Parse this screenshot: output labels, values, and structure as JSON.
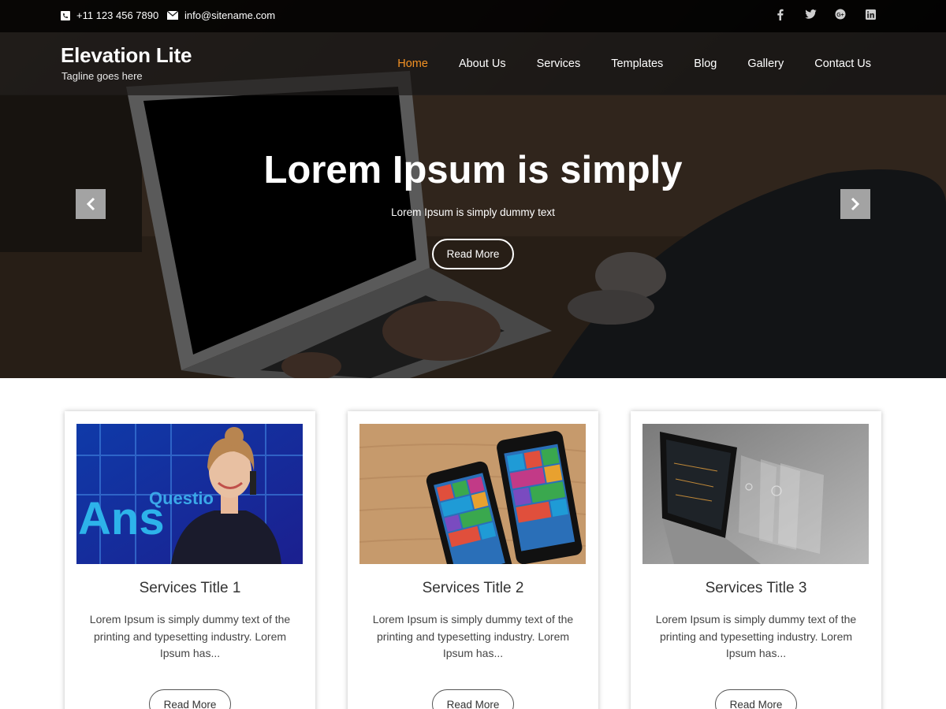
{
  "topbar": {
    "phone": "+11 123 456 7890",
    "email": "info@sitename.com",
    "social_icons": [
      "facebook-icon",
      "twitter-icon",
      "google-plus-icon",
      "linkedin-icon"
    ]
  },
  "header": {
    "site_title": "Elevation Lite",
    "tagline": "Tagline goes here",
    "nav": [
      {
        "label": "Home",
        "active": true
      },
      {
        "label": "About Us"
      },
      {
        "label": "Services"
      },
      {
        "label": "Templates"
      },
      {
        "label": "Blog"
      },
      {
        "label": "Gallery"
      },
      {
        "label": "Contact Us"
      }
    ],
    "accent_color": "#f39224"
  },
  "hero": {
    "title": "Lorem Ipsum is simply",
    "subtitle": "Lorem Ipsum is simply dummy text",
    "button": "Read More"
  },
  "services": [
    {
      "title": "Services Title 1",
      "text": "Lorem Ipsum is simply dummy text of the printing and typesetting industry. Lorem Ipsum has...",
      "button": "Read More",
      "image_text": "Questions Ans"
    },
    {
      "title": "Services Title 2",
      "text": "Lorem Ipsum is simply dummy text of the printing and typesetting industry. Lorem Ipsum has...",
      "button": "Read More"
    },
    {
      "title": "Services Title 3",
      "text": "Lorem Ipsum is simply dummy text of the printing and typesetting industry. Lorem Ipsum has...",
      "button": "Read More"
    }
  ]
}
